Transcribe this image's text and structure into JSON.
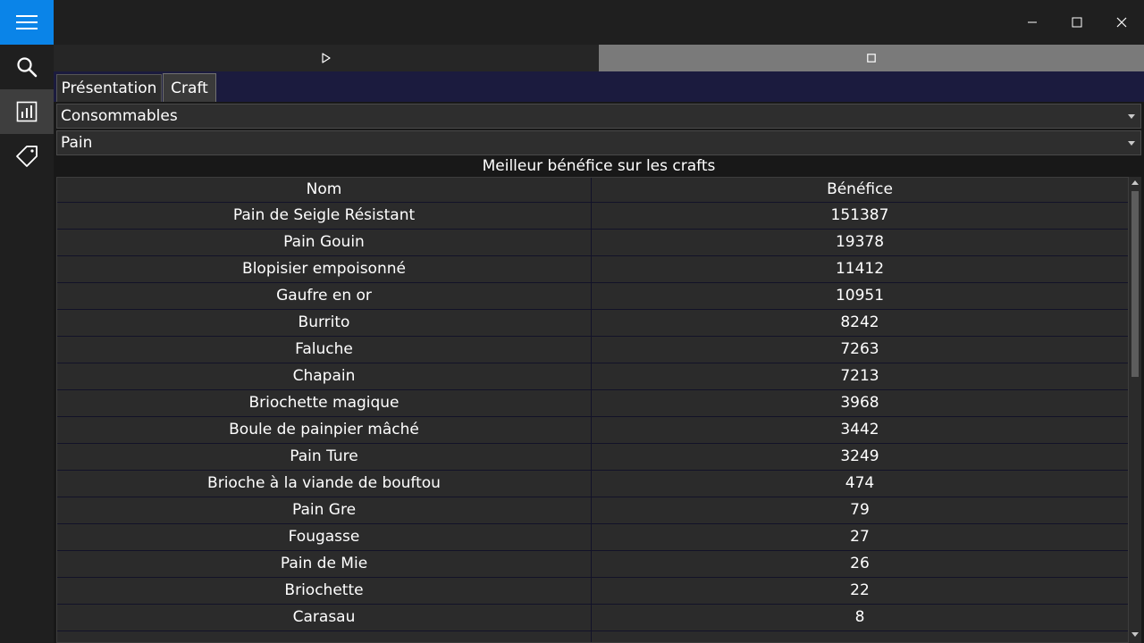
{
  "colors": {
    "accent": "#0a84e8",
    "header_band": "#1b1b3e",
    "selected_rail": "#3e3e3e"
  },
  "rail": {
    "items": [
      {
        "icon": "hamburger-menu-icon"
      },
      {
        "icon": "search-icon"
      },
      {
        "icon": "bar-chart-icon",
        "selected": true
      },
      {
        "icon": "tag-icon"
      }
    ]
  },
  "window": {
    "controls": [
      "minimize",
      "maximize",
      "close"
    ]
  },
  "media": {
    "play_icon": "play-icon",
    "stop_icon": "stop-icon"
  },
  "tabs": [
    {
      "label": "Présentation"
    },
    {
      "label": "Craft",
      "selected": true
    }
  ],
  "filters": {
    "category": "Consommables",
    "subcategory": "Pain"
  },
  "table": {
    "caption": "Meilleur bénéfice sur les crafts",
    "columns": [
      "Nom",
      "Bénéfice"
    ],
    "rows": [
      {
        "nom": "Pain de Seigle Résistant",
        "benefice": "151387"
      },
      {
        "nom": "Pain Gouin",
        "benefice": "19378"
      },
      {
        "nom": "Blopisier empoisonné",
        "benefice": "11412"
      },
      {
        "nom": "Gaufre en or",
        "benefice": "10951"
      },
      {
        "nom": "Burrito",
        "benefice": "8242"
      },
      {
        "nom": "Faluche",
        "benefice": "7263"
      },
      {
        "nom": "Chapain",
        "benefice": "7213"
      },
      {
        "nom": "Briochette magique",
        "benefice": "3968"
      },
      {
        "nom": "Boule de painpier mâché",
        "benefice": "3442"
      },
      {
        "nom": "Pain Ture",
        "benefice": "3249"
      },
      {
        "nom": "Brioche à la viande de bouftou",
        "benefice": "474"
      },
      {
        "nom": "Pain Gre",
        "benefice": "79"
      },
      {
        "nom": "Fougasse",
        "benefice": "27"
      },
      {
        "nom": "Pain de Mie",
        "benefice": "26"
      },
      {
        "nom": "Briochette",
        "benefice": "22"
      },
      {
        "nom": "Carasau",
        "benefice": "8"
      }
    ]
  }
}
